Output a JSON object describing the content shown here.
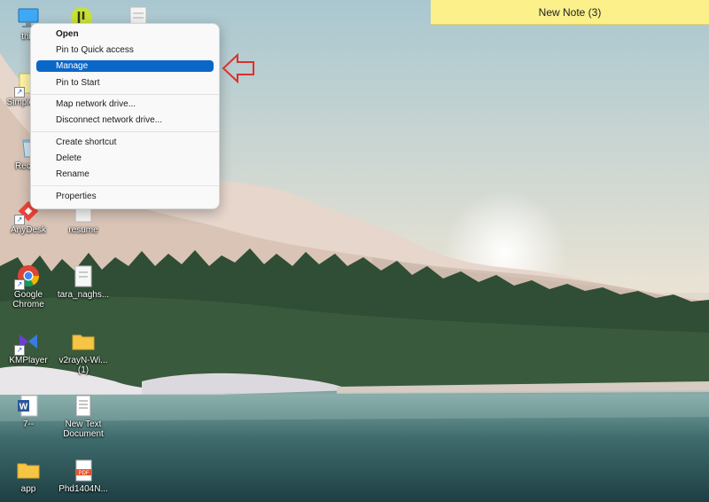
{
  "desktop_icons": [
    {
      "id": "this-pc",
      "label": "this"
    },
    {
      "id": "app-green",
      "label": ""
    },
    {
      "id": "doc-top",
      "label": ""
    },
    {
      "id": "simple-note",
      "label": "Simple Not"
    },
    {
      "id": "recycle",
      "label": "Recycl"
    },
    {
      "id": "anydesk",
      "label": "AnyDesk"
    },
    {
      "id": "resume",
      "label": "resume"
    },
    {
      "id": "chrome",
      "label": "Google Chrome"
    },
    {
      "id": "tara",
      "label": "tara_naghs..."
    },
    {
      "id": "kmplayer",
      "label": "KMPlayer"
    },
    {
      "id": "v2ray",
      "label": "v2rayN-Wi... (1)"
    },
    {
      "id": "word",
      "label": "7--"
    },
    {
      "id": "newtext",
      "label": "New Text Document"
    },
    {
      "id": "app-folder",
      "label": "app"
    },
    {
      "id": "phd-pdf",
      "label": "Phd1404N..."
    }
  ],
  "sticky_note": {
    "title": "New Note (3)"
  },
  "context_menu": {
    "groups": [
      [
        "Open",
        "Pin to Quick access",
        "Manage",
        "Pin to Start"
      ],
      [
        "Map network drive...",
        "Disconnect network drive..."
      ],
      [
        "Create shortcut",
        "Delete",
        "Rename"
      ],
      [
        "Properties"
      ]
    ],
    "selected_item": "Manage"
  },
  "colors": {
    "menu_highlight": "#0a67c8",
    "annotation_arrow": "#d9322b",
    "sticky_note": "#fbf08a"
  }
}
